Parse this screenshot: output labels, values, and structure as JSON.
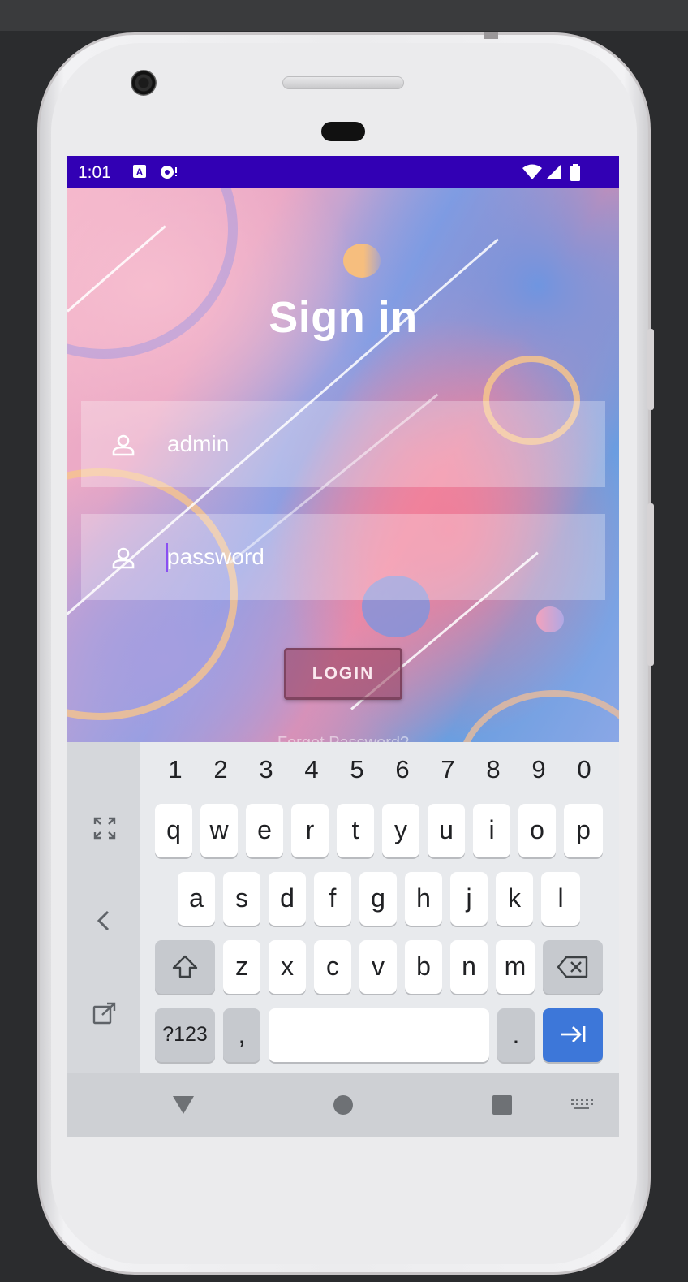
{
  "status_bar": {
    "time": "1:01",
    "icons": [
      "a-icon",
      "notification-icon",
      "wifi-icon",
      "signal-icon",
      "battery-icon"
    ]
  },
  "login_screen": {
    "title": "Sign in",
    "username_field": {
      "value": "admin",
      "icon": "person-icon"
    },
    "password_field": {
      "placeholder": "password",
      "icon": "person-icon"
    },
    "login_button": "LOGIN",
    "forgot_password": "Forgot Password?"
  },
  "keyboard": {
    "number_row": [
      "1",
      "2",
      "3",
      "4",
      "5",
      "6",
      "7",
      "8",
      "9",
      "0"
    ],
    "row1": [
      "q",
      "w",
      "e",
      "r",
      "t",
      "y",
      "u",
      "i",
      "o",
      "p"
    ],
    "row2": [
      "a",
      "s",
      "d",
      "f",
      "g",
      "h",
      "j",
      "k",
      "l"
    ],
    "row3": [
      "z",
      "x",
      "c",
      "v",
      "b",
      "n",
      "m"
    ],
    "symbols_key": "?123",
    "comma_key": ",",
    "period_key": ".",
    "side_icons": [
      "fullscreen-icon",
      "back-arrow-icon",
      "popout-icon"
    ],
    "accent_color": "#3d77d9"
  },
  "nav_bar": {
    "icons": [
      "back-triangle-icon",
      "home-circle-icon",
      "recents-square-icon",
      "keyboard-switch-icon"
    ]
  },
  "colors": {
    "status_bar": "#3200b4",
    "login_button": "#963c5a"
  }
}
